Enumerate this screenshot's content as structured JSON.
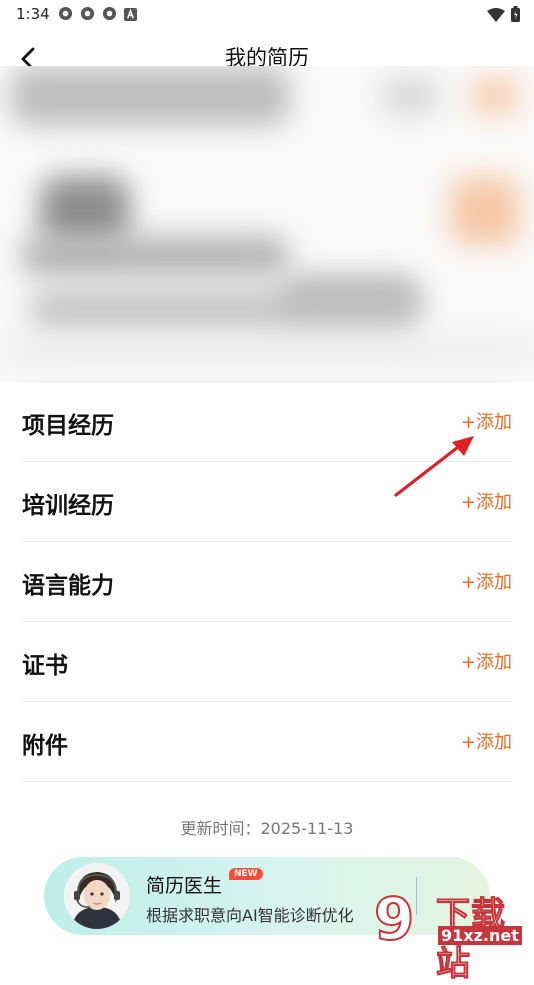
{
  "status_bar": {
    "time": "1:34"
  },
  "header": {
    "title": "我的简历"
  },
  "sections": [
    {
      "title": "项目经历",
      "action": "+添加"
    },
    {
      "title": "培训经历",
      "action": "+添加"
    },
    {
      "title": "语言能力",
      "action": "+添加"
    },
    {
      "title": "证书",
      "action": "+添加"
    },
    {
      "title": "附件",
      "action": "+添加"
    }
  ],
  "footer": {
    "update_time": "更新时间：2025-11-13"
  },
  "resume_doctor": {
    "title": "简历医生",
    "badge": "NEW",
    "subtitle": "根据求职意向AI智能诊断优化"
  },
  "watermark": {
    "brand": "下载站",
    "url": "91xz.net"
  },
  "colors": {
    "accent": "#f06a1f",
    "arrow": "#e02020"
  }
}
